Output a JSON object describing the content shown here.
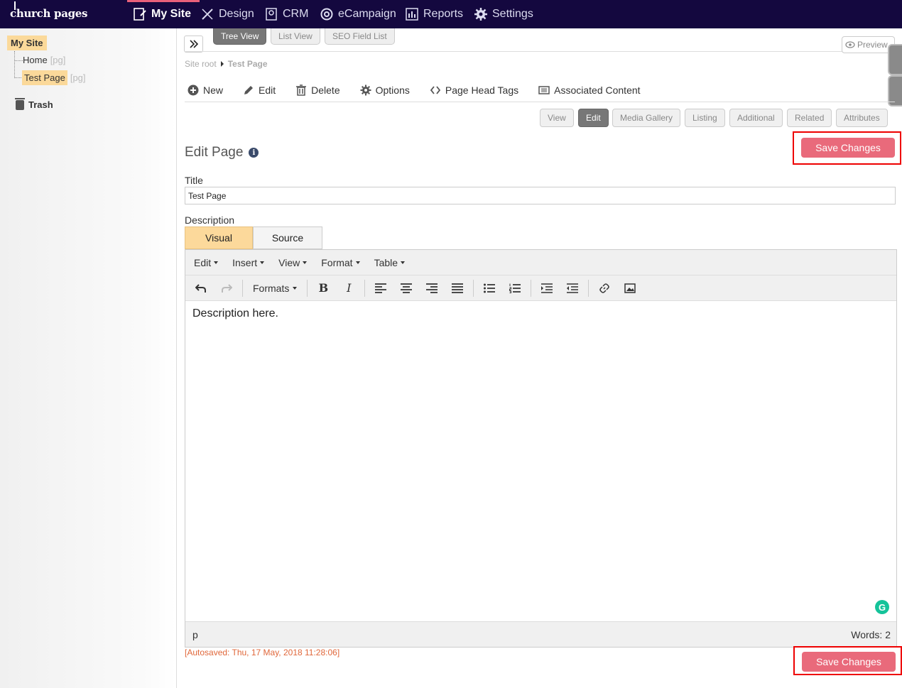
{
  "app": {
    "logo_text": "church pages"
  },
  "nav": [
    {
      "label": "My Site",
      "icon": "page-edit-icon",
      "active": true
    },
    {
      "label": "Design",
      "icon": "pencil-ruler-icon"
    },
    {
      "label": "CRM",
      "icon": "contacts-icon"
    },
    {
      "label": "eCampaign",
      "icon": "at-sign-icon"
    },
    {
      "label": "Reports",
      "icon": "bar-chart-icon"
    },
    {
      "label": "Settings",
      "icon": "gear-icon"
    }
  ],
  "sidebar": {
    "root": "My Site",
    "items": [
      {
        "label": "Home",
        "tag": "[pg]"
      },
      {
        "label": "Test Page",
        "tag": "[pg]"
      }
    ],
    "trash": "Trash"
  },
  "view_tabs": [
    "Tree View",
    "List View",
    "SEO Field List"
  ],
  "preview": "Preview",
  "breadcrumb": {
    "root": "Site root",
    "current": "Test Page"
  },
  "toolbar": [
    "New",
    "Edit",
    "Delete",
    "Options",
    "Page Head Tags",
    "Associated Content"
  ],
  "sub_tabs": [
    "View",
    "Edit",
    "Media Gallery",
    "Listing",
    "Additional",
    "Related",
    "Attributes"
  ],
  "save_label": "Save Changes",
  "edit_page": {
    "heading": "Edit Page",
    "info": "i"
  },
  "form": {
    "title_label": "Title",
    "title_value": "Test Page",
    "description_label": "Description",
    "mode_visual": "Visual",
    "mode_source": "Source"
  },
  "editor": {
    "menus": [
      "Edit",
      "Insert",
      "View",
      "Format",
      "Table"
    ],
    "formats_label": "Formats",
    "content": "Description here.",
    "status_path": "p",
    "word_count": "Words: 2",
    "grammarly": "G"
  },
  "autosave": "[Autosaved: Thu, 17 May, 2018 11:28:06]",
  "colors": {
    "nav_bg": "#14083f",
    "accent": "#e96a7b",
    "highlight": "#fbd99a",
    "autosave": "#e0673a"
  }
}
